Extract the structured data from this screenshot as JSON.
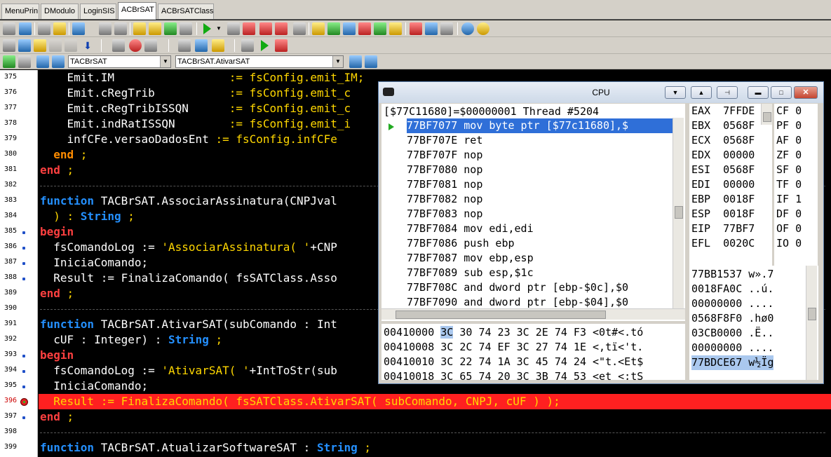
{
  "tabs": [
    "MenuPrin",
    "DModulo",
    "LoginSIS",
    "ACBrSAT",
    "ACBrSATClass"
  ],
  "active_tab": "ACBrSAT",
  "toolbar": {
    "class_combo": "TACBrSAT",
    "method_combo": "TACBrSAT.AtivarSAT"
  },
  "gutter": {
    "lines": [
      "375",
      "376",
      "377",
      "378",
      "379",
      "380",
      "381",
      "382",
      "383",
      "384",
      "385",
      "386",
      "387",
      "388",
      "389",
      "390",
      "391",
      "392",
      "393",
      "394",
      "395",
      "396",
      "397",
      "398",
      "399"
    ],
    "dots": [
      "385",
      "386",
      "387",
      "388",
      "393",
      "394",
      "395",
      "397"
    ],
    "breakpoint": "396"
  },
  "code": {
    "l375a": "    Emit.IM",
    "l375b": "                 := fsConfig.emit_IM;",
    "l376a": "    Emit.cRegTrib",
    "l376b": "           := fsConfig.emit_c",
    "l377a": "    Emit.cRegTribISSQN",
    "l377b": "      := fsConfig.emit_c",
    "l378a": "    Emit.indRatISSQN",
    "l378b": "        := fsConfig.emit_i",
    "l379a": "    infCFe.versaoDadosEnt",
    "l379b": " := fsConfig.infCFe",
    "l380a": "  ",
    "l380k": "end",
    "l380c": " ;",
    "l381k": "end",
    "l381c": " ;",
    "l383k": "function",
    "l383c": " TACBrSAT.AssociarAssinatura(CNPJval",
    "l384c": "  ) : ",
    "l384k": "String",
    "l384d": " ;",
    "l385k": "begin",
    "l386a": "  fsComandoLog := ",
    "l386s": "'AssociarAssinatura( '",
    "l386b": "+CNP",
    "l387a": "  IniciaComando;",
    "l388a": "  Result := FinalizaComando( fsSATClass.Asso",
    "l389k": "end",
    "l389c": " ;",
    "l391k": "function",
    "l391c": " TACBrSAT.AtivarSAT(subComando : Int",
    "l392c": "  cUF : Integer) : ",
    "l392k": "String",
    "l392d": " ;",
    "l393k": "begin",
    "l394a": "  fsComandoLog := ",
    "l394s": "'AtivarSAT( '",
    "l394b": "+IntToStr(sub",
    "l395a": "  IniciaComando;",
    "l396a": "  Result := FinalizaComando( fsSATClass.AtivarSAT( subComando, CNPJ, cUF ) );",
    "l397k": "end",
    "l397c": " ;",
    "l399k": "function",
    "l399c": " TACBrSAT.AtualizarSoftwareSAT : ",
    "l399t": "String",
    "l399d": " ;"
  },
  "cpu": {
    "title": "CPU",
    "header": "[$77C11680]=$00000001 Thread #5204",
    "disasm": [
      "77BF7077 mov byte ptr [$77c11680],$",
      "77BF707E ret",
      "77BF707F nop",
      "77BF7080 nop",
      "77BF7081 nop",
      "77BF7082 nop",
      "77BF7083 nop",
      "77BF7084 mov edi,edi",
      "77BF7086 push ebp",
      "77BF7087 mov ebp,esp",
      "77BF7089 sub esp,$1c",
      "77BF708C and dword ptr [ebp-$0c],$0",
      "77BF7090 and dword ptr [ebp-$04],$0"
    ],
    "registers": [
      "EAX  7FFDE",
      "EBX  0568F",
      "ECX  0568F",
      "EDX  00000",
      "ESI  0568F",
      "EDI  00000",
      "EBP  0018F",
      "ESP  0018F",
      "EIP  77BF7",
      "EFL  0020C"
    ],
    "flags": [
      "CF 0",
      "PF 0",
      "AF 0",
      "ZF 0",
      "SF 0",
      "TF 0",
      "IF 1",
      "DF 0",
      "OF 0",
      "IO 0"
    ],
    "memory": [
      {
        "addr": "00410000",
        "first": "3C",
        "rest": " 30 74 23 3C 2E 74 F3",
        "ascii": " <0t#<.tó"
      },
      {
        "addr": "00410008",
        "first": "",
        "rest": "3C 2C 74 EF 3C 27 74 1E",
        "ascii": " <,tï<'t."
      },
      {
        "addr": "00410010",
        "first": "",
        "rest": "3C 22 74 1A 3C 45 74 24",
        "ascii": " <\"t.<Et$"
      },
      {
        "addr": "00410018",
        "first": "",
        "rest": "3C 65 74 20 3C 3B 74 53",
        "ascii": " <et <;tS"
      }
    ],
    "stack": [
      "77BB1537 w».7",
      "0018FA0C ..ú.",
      "00000000 ....",
      "0568F8F0 .hø0",
      "03CB0000 .Ë..",
      "00000000 ....",
      "77BDCE67 w½Ïg"
    ]
  }
}
